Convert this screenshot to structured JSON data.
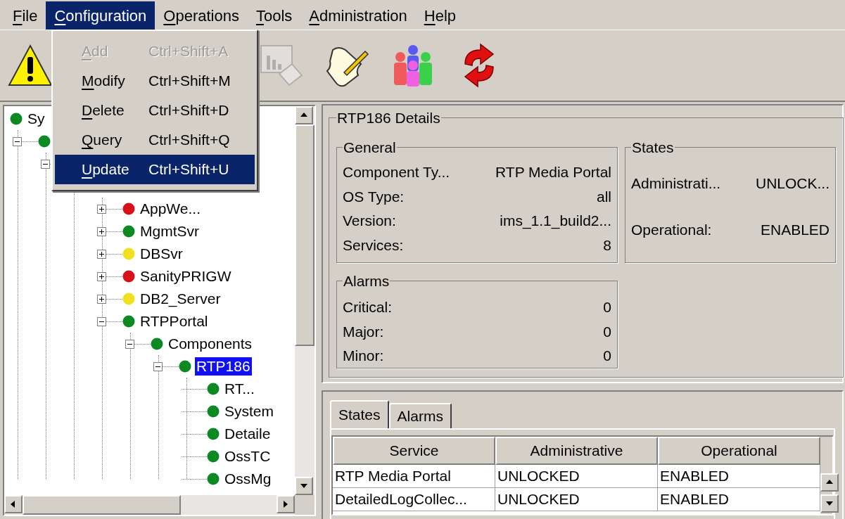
{
  "menu_bar": [
    {
      "label": "File",
      "first_letter_underlined": true,
      "selected": false
    },
    {
      "label": "Configuration",
      "first_letter_underlined": true,
      "selected": true
    },
    {
      "label": "Operations",
      "first_letter_underlined": true,
      "selected": false
    },
    {
      "label": "Tools",
      "first_letter_underlined": true,
      "selected": false
    },
    {
      "label": "Administration",
      "first_letter_underlined": true,
      "selected": false
    },
    {
      "label": "Help",
      "first_letter_underlined": true,
      "selected": false
    }
  ],
  "menu": [
    {
      "label": "Add",
      "first_letter_underlined": true,
      "shortcut": "Ctrl+Shift+A",
      "disabled": true,
      "selected": false
    },
    {
      "label": "Modify",
      "first_letter_underlined": true,
      "shortcut": "Ctrl+Shift+M",
      "disabled": false,
      "selected": false
    },
    {
      "label": "Delete",
      "first_letter_underlined": true,
      "shortcut": "Ctrl+Shift+D",
      "disabled": false,
      "selected": false
    },
    {
      "label": "Query",
      "first_letter_underlined": true,
      "shortcut": "Ctrl+Shift+Q",
      "disabled": false,
      "selected": false
    },
    {
      "label": "Update",
      "first_letter_underlined": true,
      "shortcut": "Ctrl+Shift+U",
      "disabled": false,
      "selected": true
    }
  ],
  "toolbar": [
    {
      "kind": "warning",
      "disabled": false
    },
    {
      "kind": "report",
      "disabled": true
    },
    {
      "kind": "script",
      "disabled": false
    },
    {
      "kind": "users",
      "disabled": false
    },
    {
      "kind": "refresh",
      "disabled": false
    }
  ],
  "tree": [
    {
      "label": "Sy",
      "color": "#0b8a22",
      "selected": false,
      "children": [
        {
          "color": "#0b8a22",
          "expanded": true,
          "children": [
            {
              "expanded": true,
              "children": [
                {
                  "children": [
                    {
                      "label": "AppWe...",
                      "color": "#d8101a",
                      "expanded": false,
                      "selected": false
                    },
                    {
                      "label": "MgmtSvr",
                      "color": "#0b8a22",
                      "expanded": false,
                      "selected": false
                    },
                    {
                      "label": "DBSvr",
                      "color": "#f0e020",
                      "expanded": false,
                      "selected": false
                    },
                    {
                      "label": "SanityPRIGW",
                      "color": "#d8101a",
                      "expanded": false,
                      "selected": false
                    },
                    {
                      "label": "DB2_Server",
                      "color": "#f0e020",
                      "expanded": false,
                      "selected": false
                    },
                    {
                      "label": "RTPPortal",
                      "color": "#0b8a22",
                      "expanded": true,
                      "selected": false,
                      "children": [
                        {
                          "label": "Components",
                          "color": "#0b8a22",
                          "expanded": true,
                          "selected": false,
                          "children": [
                            {
                              "label": "RTP186",
                              "color": "#0b8a22",
                              "expanded": true,
                              "selected": true,
                              "children": [
                                {
                                  "label": "RT...",
                                  "color": "#0b8a22",
                                  "selected": false
                                },
                                {
                                  "label": "System",
                                  "color": "#0b8a22",
                                  "selected": false
                                },
                                {
                                  "label": "Detaile",
                                  "color": "#0b8a22",
                                  "selected": false
                                },
                                {
                                  "label": "OssTC",
                                  "color": "#0b8a22",
                                  "selected": false
                                },
                                {
                                  "label": "OssMg",
                                  "color": "#0b8a22",
                                  "selected": false
                                }
                              ]
                            }
                          ]
                        }
                      ]
                    }
                  ]
                }
              ]
            }
          ]
        }
      ]
    }
  ],
  "details": {
    "title": "RTP186 Details",
    "general": {
      "title": "General",
      "rows": [
        {
          "label": "Component Ty...",
          "value": "RTP Media Portal"
        },
        {
          "label": "OS Type:",
          "value": "all"
        },
        {
          "label": "Version:",
          "value": "ims_1.1_build2..."
        },
        {
          "label": "Services:",
          "value": "8"
        }
      ]
    },
    "states": {
      "title": "States",
      "rows": [
        {
          "label": "Administrati...",
          "value": "UNLOCK..."
        },
        {
          "label": "Operational:",
          "value": "ENABLED"
        }
      ]
    },
    "alarms": {
      "title": "Alarms",
      "rows": [
        {
          "label": "Critical:",
          "value": "0"
        },
        {
          "label": "Major:",
          "value": "0"
        },
        {
          "label": "Minor:",
          "value": "0"
        }
      ]
    }
  },
  "tabs": [
    {
      "label": "States",
      "selected": true
    },
    {
      "label": "Alarms",
      "selected": false
    }
  ],
  "table": {
    "columns": [
      "Service",
      "Administrative",
      "Operational"
    ],
    "rows": [
      [
        "RTP Media Portal",
        "UNLOCKED",
        "ENABLED"
      ],
      [
        "DetailedLogCollec...",
        "UNLOCKED",
        "ENABLED"
      ]
    ]
  }
}
